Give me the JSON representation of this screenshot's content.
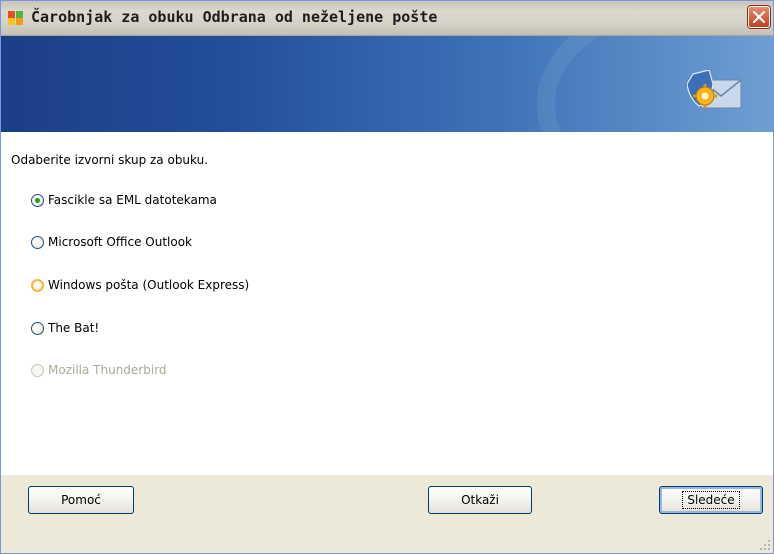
{
  "window": {
    "title": "Čarobnjak za obuku Odbrana od neželjene pošte"
  },
  "content": {
    "prompt": "Odaberite izvorni skup za obuku.",
    "options": [
      {
        "label": "Fascikle sa EML datotekama",
        "state": "checked"
      },
      {
        "label": "Microsoft Office Outlook",
        "state": "normal"
      },
      {
        "label": "Windows pošta (Outlook Express)",
        "state": "hover"
      },
      {
        "label": "The Bat!",
        "state": "normal"
      },
      {
        "label": "Mozilla Thunderbird",
        "state": "disabled"
      }
    ]
  },
  "footer": {
    "help_label": "Pomoć",
    "cancel_label": "Otkaži",
    "next_label": "Sledeće"
  },
  "colors": {
    "banner_start": "#1b3f86",
    "banner_end": "#6f9ed3",
    "radio_selected": "#21a121",
    "radio_hover": "#f5b83d",
    "close_button": "#c2401f"
  }
}
